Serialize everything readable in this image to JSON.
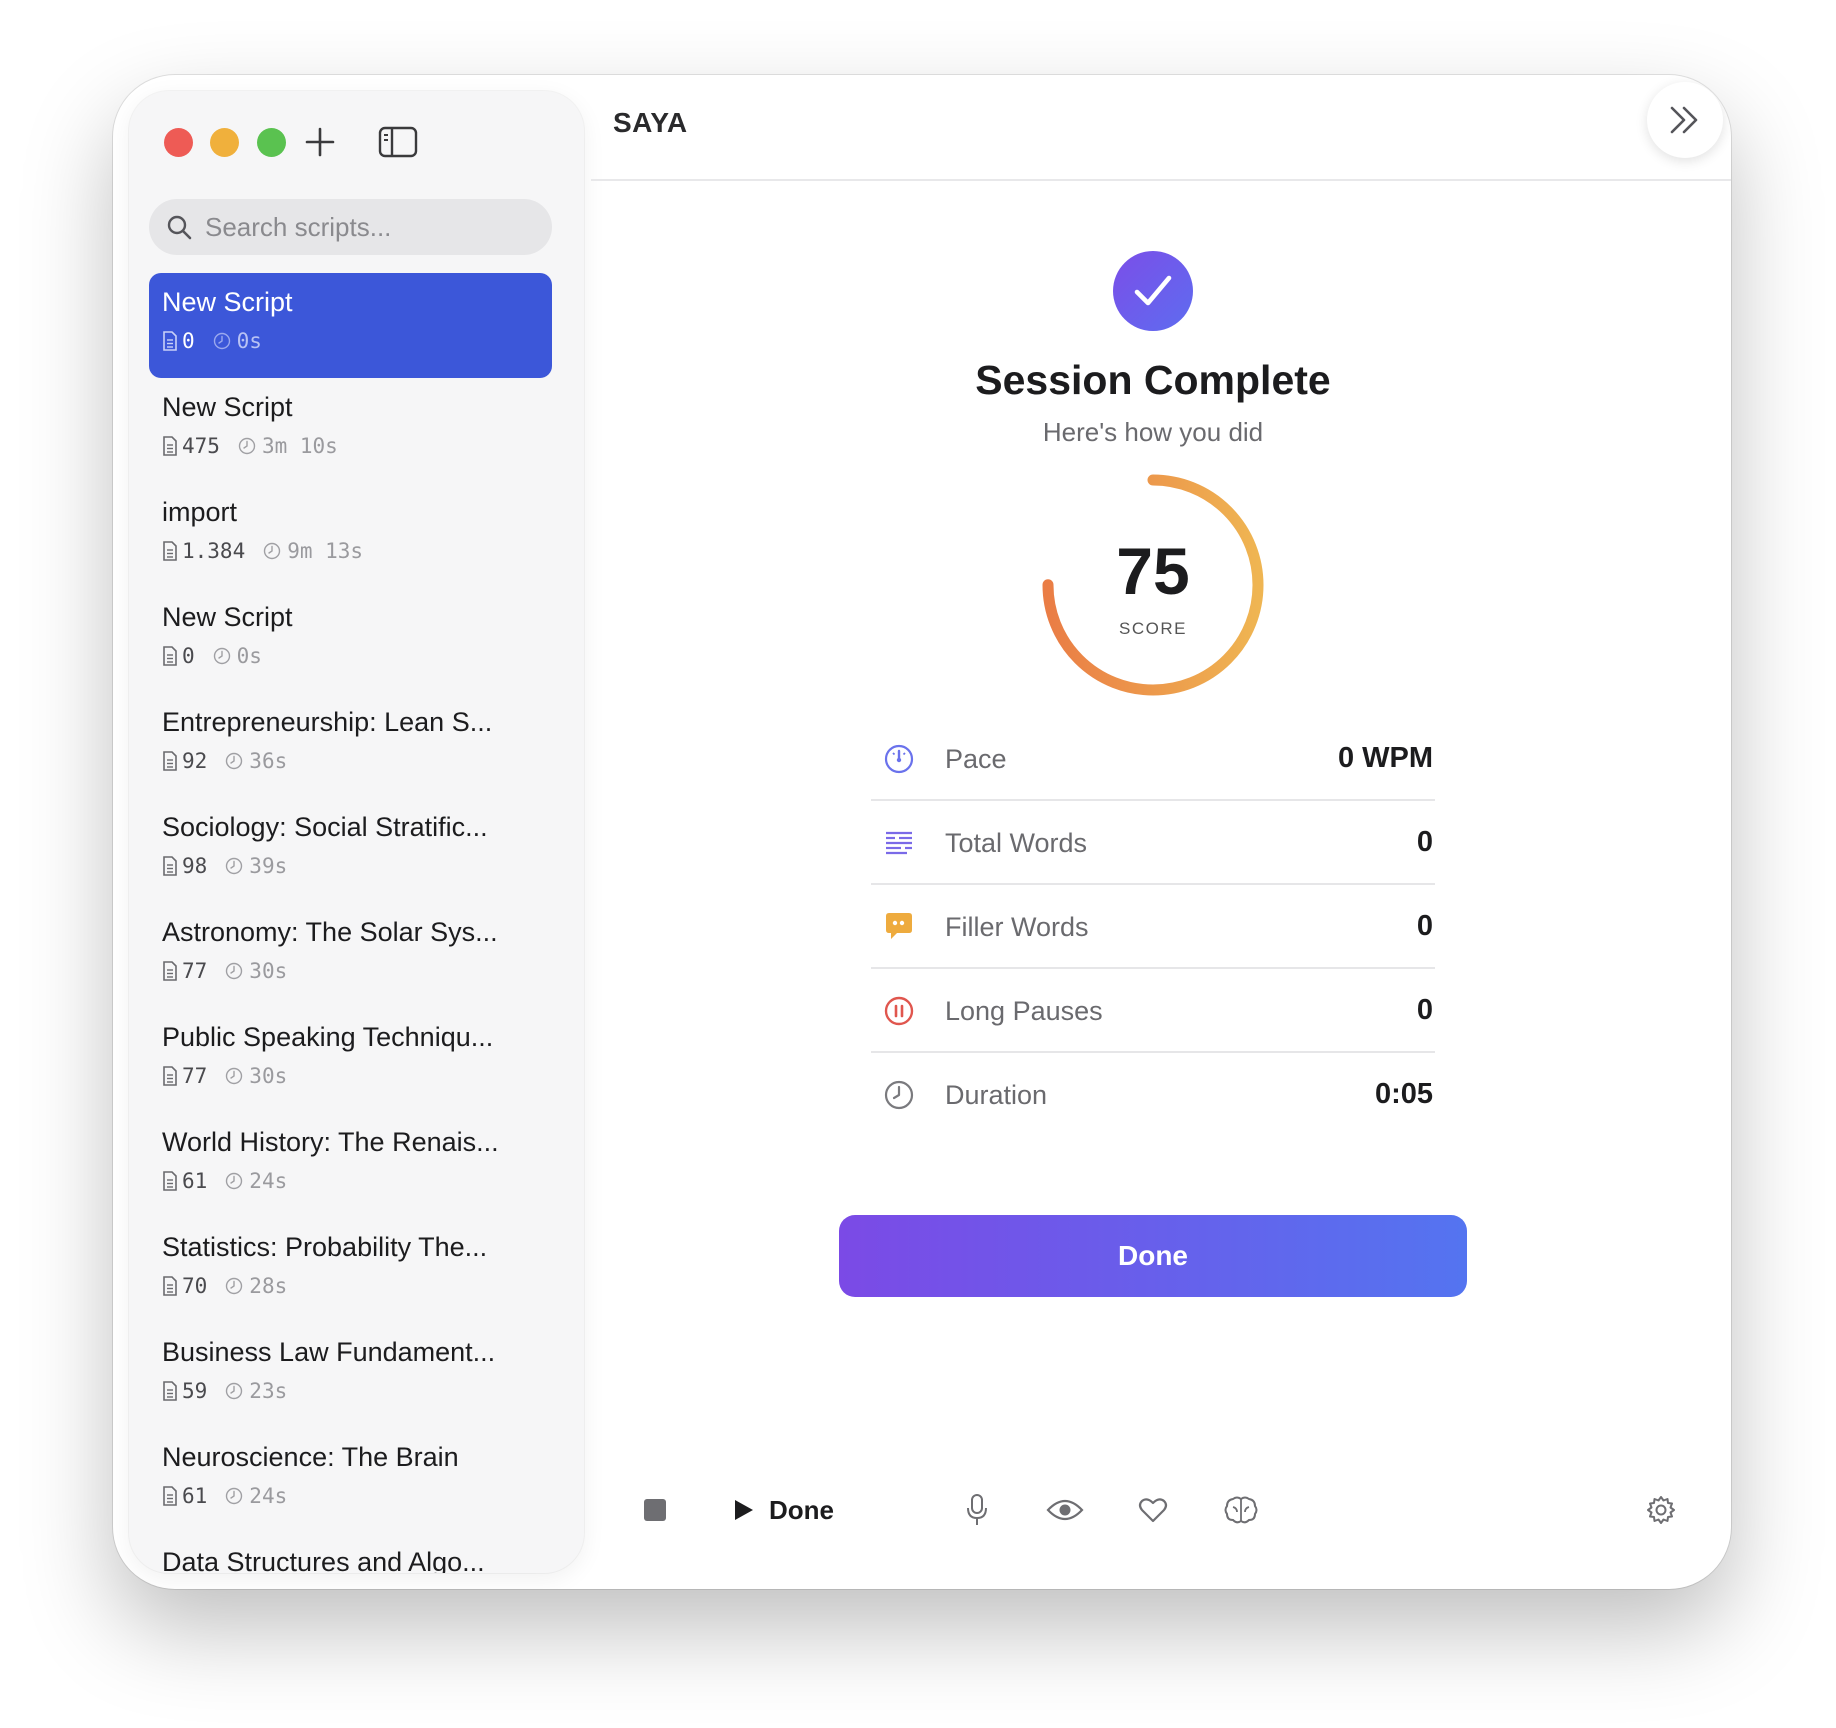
{
  "app": {
    "title": "SAYA"
  },
  "sidebar": {
    "search_placeholder": "Search scripts...",
    "scripts": [
      {
        "title": "New Script",
        "words": "0",
        "duration": "0s",
        "active": true
      },
      {
        "title": "New Script",
        "words": "475",
        "duration": "3m 10s"
      },
      {
        "title": "import",
        "words": "1.384",
        "duration": "9m 13s"
      },
      {
        "title": "New Script",
        "words": "0",
        "duration": "0s"
      },
      {
        "title": "Entrepreneurship: Lean S...",
        "words": "92",
        "duration": "36s"
      },
      {
        "title": "Sociology: Social Stratific...",
        "words": "98",
        "duration": "39s"
      },
      {
        "title": "Astronomy: The Solar Sys...",
        "words": "77",
        "duration": "30s"
      },
      {
        "title": "Public Speaking Techniqu...",
        "words": "77",
        "duration": "30s"
      },
      {
        "title": "World History: The Renais...",
        "words": "61",
        "duration": "24s"
      },
      {
        "title": "Statistics: Probability The...",
        "words": "70",
        "duration": "28s"
      },
      {
        "title": "Business Law Fundament...",
        "words": "59",
        "duration": "23s"
      },
      {
        "title": "Neuroscience: The Brain",
        "words": "61",
        "duration": "24s"
      },
      {
        "title": "Data Structures and Algo...",
        "words": "",
        "duration": ""
      }
    ]
  },
  "session": {
    "title": "Session Complete",
    "subtitle": "Here's how you did",
    "score": "75",
    "score_fraction": 0.75,
    "score_label": "SCORE",
    "stats": [
      {
        "icon": "speedometer-icon",
        "label": "Pace",
        "value": "0 WPM"
      },
      {
        "icon": "text-lines-icon",
        "label": "Total Words",
        "value": "0"
      },
      {
        "icon": "speech-bubble-icon",
        "label": "Filler Words",
        "value": "0"
      },
      {
        "icon": "pause-circle-icon",
        "label": "Long Pauses",
        "value": "0"
      },
      {
        "icon": "clock-icon",
        "label": "Duration",
        "value": "0:05"
      }
    ],
    "done_button": "Done"
  },
  "toolbar": {
    "play_label": "Done"
  },
  "colors": {
    "accent": "#3c57d9",
    "gradient_start": "#7b4ae6",
    "gradient_end": "#5474f0",
    "score_orange": "#ea7d45",
    "score_yellow": "#efb552"
  }
}
